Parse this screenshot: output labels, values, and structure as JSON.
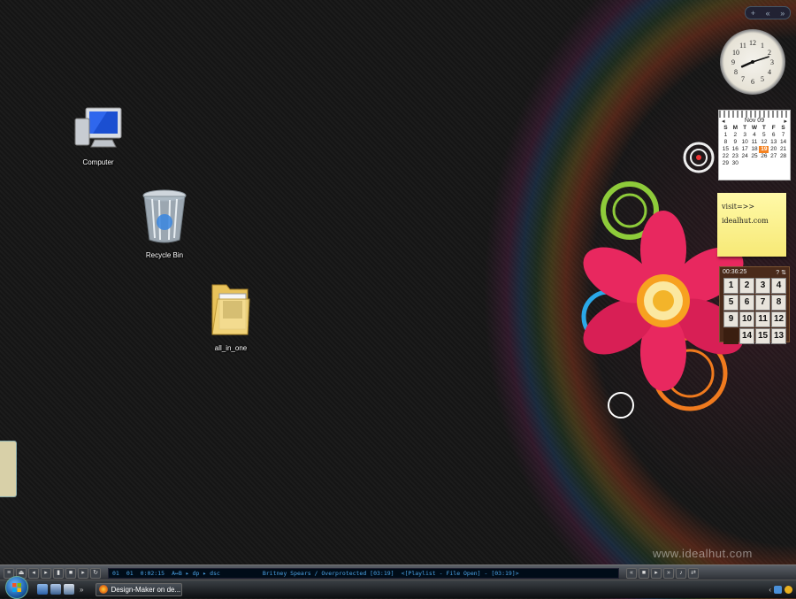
{
  "desktop": {
    "icons": [
      {
        "label": "Computer",
        "icon": "computer-icon"
      },
      {
        "label": "Recycle Bin",
        "icon": "recycle-bin-icon"
      },
      {
        "label": "all_in_one",
        "icon": "folder-icon"
      }
    ],
    "watermark": "www.idealhut.com"
  },
  "sidebar": {
    "controls": {
      "add": "+",
      "prev": "«",
      "next": "»"
    },
    "clock": {
      "numbers": [
        "12",
        "1",
        "2",
        "3",
        "4",
        "5",
        "6",
        "7",
        "8",
        "9",
        "10",
        "11"
      ],
      "hour": 8,
      "minute": 12
    },
    "calendar": {
      "month": "Nov 09",
      "weekdays": [
        "S",
        "M",
        "T",
        "W",
        "T",
        "F",
        "S"
      ],
      "days": [
        "1",
        "2",
        "3",
        "4",
        "5",
        "6",
        "7",
        "8",
        "9",
        "10",
        "11",
        "12",
        "13",
        "14",
        "15",
        "16",
        "17",
        "18",
        "19",
        "20",
        "21",
        "22",
        "23",
        "24",
        "25",
        "26",
        "27",
        "28",
        "29",
        "30"
      ],
      "today": "19"
    },
    "note": {
      "line1": "visit=>>",
      "line2": "idealhut.com"
    },
    "puzzle": {
      "timer": "00:36:25",
      "tiles": [
        "1",
        "2",
        "3",
        "4",
        "5",
        "6",
        "7",
        "8",
        "9",
        "10",
        "11",
        "12",
        "",
        "14",
        "15",
        "13"
      ]
    }
  },
  "media_bar": {
    "track_num": "01",
    "track_count": "01",
    "time": "0:02:15",
    "controls": "A↔B ▸ dp ▸ dsc",
    "now_playing": "Britney Spears / Overprotected  [03:19]",
    "playlist": "<[Playlist - File Open] - [03:19]>"
  },
  "taskbar": {
    "task": "Design-Maker on de...",
    "show_more": "»",
    "tray_arrow": "‹"
  },
  "colors": {
    "accent": "#f58220",
    "lcd_text": "#4aa3e6",
    "note": "#fff9a8"
  }
}
